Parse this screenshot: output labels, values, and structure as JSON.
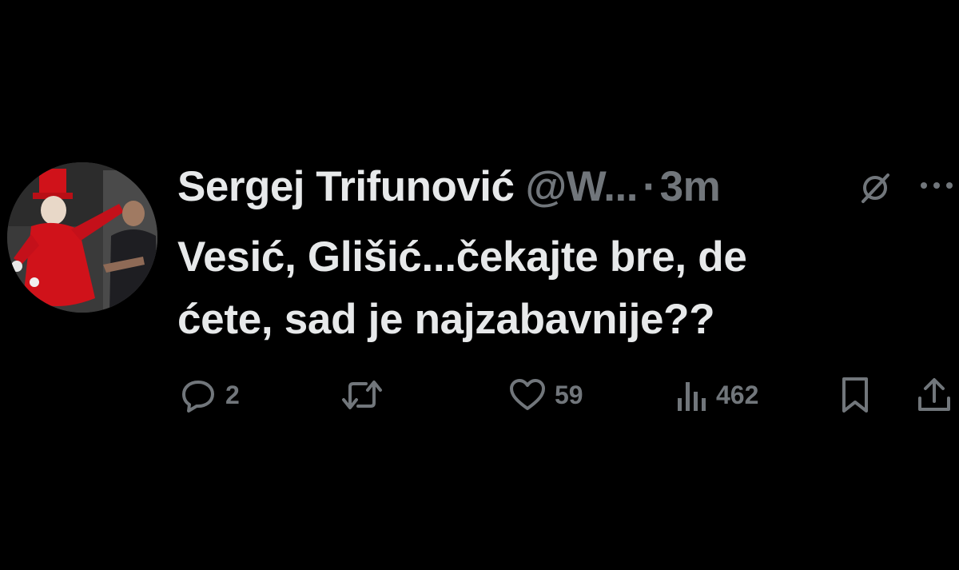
{
  "author": {
    "display_name": "Sergej Trifunović",
    "handle": "@W...",
    "separator": "·",
    "timestamp": "3m"
  },
  "tweet": {
    "text_line1": "Vesić, Glišić...čekajte bre, de",
    "text_line2": "ćete, sad je najzabavnije??"
  },
  "actions": {
    "replies": "2",
    "likes": "59",
    "views": "462"
  },
  "icons": {
    "header": [
      "grok-icon",
      "more-icon"
    ],
    "footer": [
      "reply-icon",
      "retweet-icon",
      "like-icon",
      "views-icon",
      "bookmark-icon",
      "share-icon"
    ]
  },
  "colors": {
    "background": "#000000",
    "primary_text": "#e7e9ea",
    "secondary_text": "#71767b"
  }
}
